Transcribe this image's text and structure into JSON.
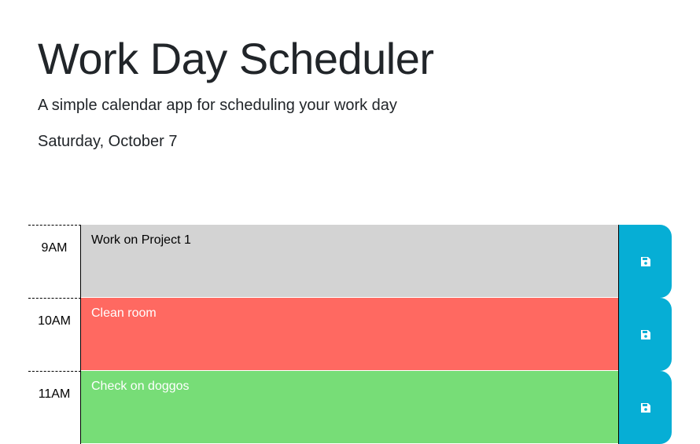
{
  "header": {
    "title": "Work Day Scheduler",
    "subtitle": "A simple calendar app for scheduling your work day",
    "current_day": "Saturday, October 7"
  },
  "time_blocks": [
    {
      "hour": "9AM",
      "text": "Work on Project 1",
      "status": "past"
    },
    {
      "hour": "10AM",
      "text": "Clean room",
      "status": "present"
    },
    {
      "hour": "11AM",
      "text": "Check on doggos",
      "status": "future"
    }
  ],
  "colors": {
    "past": "#d3d3d3",
    "present": "#ff6961",
    "future": "#77dd77",
    "save_button": "#06aed5"
  },
  "icons": {
    "save": "floppy-disk-icon"
  }
}
